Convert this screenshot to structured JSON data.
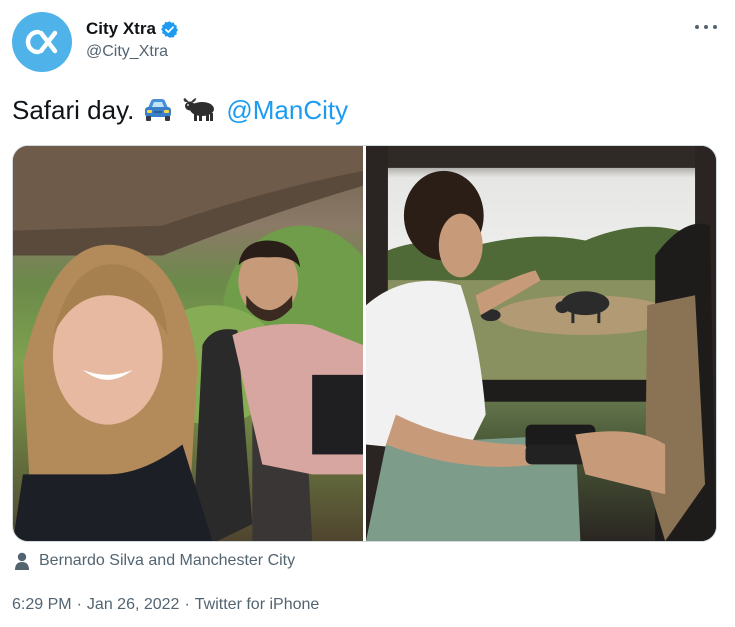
{
  "author": {
    "display_name": "City Xtra",
    "handle": "@City_Xtra",
    "verified": true,
    "avatar_icon": "city-xtra-logo-icon",
    "avatar_color": "#4fb3ea"
  },
  "tweet": {
    "text": "Safari day.",
    "emojis": [
      "car-icon",
      "water-buffalo-icon"
    ],
    "mention": "@ManCity"
  },
  "media": {
    "photo_count": 2
  },
  "tagged": {
    "icon": "person-icon",
    "text": "Bernardo Silva and Manchester City"
  },
  "meta": {
    "time": "6:29 PM",
    "date": "Jan 26, 2022",
    "source": "Twitter for iPhone",
    "separator": "·"
  },
  "colors": {
    "text_primary": "#0f1419",
    "text_secondary": "#536471",
    "link": "#1d9bf0",
    "verified": "#1d9bf0"
  }
}
